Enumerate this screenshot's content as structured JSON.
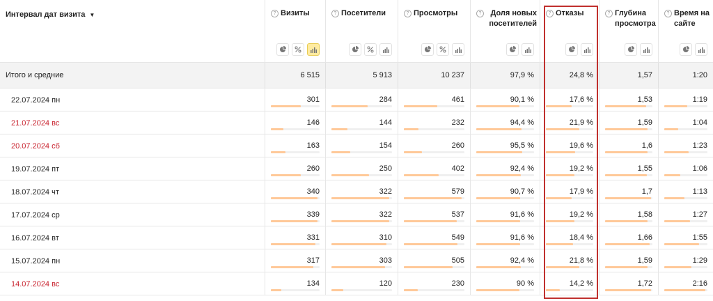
{
  "header": {
    "dimension": {
      "label": "Интервал дат визита",
      "caret": "▼"
    },
    "metrics": [
      {
        "name": "Визиты",
        "tools": [
          "pie-chart-icon",
          "percent-icon",
          "bar-chart-icon"
        ],
        "active_tool": 2
      },
      {
        "name": "Посетители",
        "tools": [
          "pie-chart-icon",
          "percent-icon",
          "bar-chart-icon"
        ],
        "active_tool": -1
      },
      {
        "name": "Просмотры",
        "tools": [
          "pie-chart-icon",
          "percent-icon",
          "bar-chart-icon"
        ],
        "active_tool": -1
      },
      {
        "name": "Доля новых посетителей",
        "tools": [
          "pie-chart-icon",
          "bar-chart-icon"
        ],
        "active_tool": -1
      },
      {
        "name": "Отказы",
        "tools": [
          "pie-chart-icon",
          "bar-chart-icon"
        ],
        "active_tool": -1
      },
      {
        "name": "Глубина просмотра",
        "tools": [
          "pie-chart-icon",
          "bar-chart-icon"
        ],
        "active_tool": -1
      },
      {
        "name": "Время на сайте",
        "tools": [
          "pie-chart-icon",
          "bar-chart-icon"
        ],
        "active_tool": -1
      }
    ],
    "info_glyph": "?"
  },
  "totals": {
    "label": "Итого и средние",
    "values": [
      "6 515",
      "5 913",
      "10 237",
      "97,9 %",
      "24,8 %",
      "1,57",
      "1:20"
    ]
  },
  "rows": [
    {
      "date": "22.07.2024 пн",
      "weekend": false,
      "values": [
        "301",
        "284",
        "461",
        "90,1 %",
        "17,6 %",
        "1,53",
        "1:19"
      ],
      "bars": [
        0.62,
        0.6,
        0.55,
        0.75,
        0.55,
        0.87,
        0.53
      ]
    },
    {
      "date": "21.07.2024 вс",
      "weekend": true,
      "values": [
        "146",
        "144",
        "232",
        "94,4 %",
        "21,9 %",
        "1,59",
        "1:04"
      ],
      "bars": [
        0.25,
        0.27,
        0.24,
        0.78,
        0.7,
        0.9,
        0.33
      ]
    },
    {
      "date": "20.07.2024 сб",
      "weekend": true,
      "values": [
        "163",
        "154",
        "260",
        "95,5 %",
        "19,6 %",
        "1,6",
        "1:23"
      ],
      "bars": [
        0.3,
        0.31,
        0.3,
        0.8,
        0.62,
        0.9,
        0.57
      ]
    },
    {
      "date": "19.07.2024 пт",
      "weekend": false,
      "values": [
        "260",
        "250",
        "402",
        "92,4 %",
        "19,2 %",
        "1,55",
        "1:06"
      ],
      "bars": [
        0.62,
        0.62,
        0.57,
        0.77,
        0.6,
        0.88,
        0.37
      ]
    },
    {
      "date": "18.07.2024 чт",
      "weekend": false,
      "values": [
        "340",
        "322",
        "579",
        "90,7 %",
        "17,9 %",
        "1,7",
        "1:13"
      ],
      "bars": [
        0.95,
        0.95,
        0.95,
        0.76,
        0.55,
        0.97,
        0.47
      ]
    },
    {
      "date": "17.07.2024 ср",
      "weekend": false,
      "values": [
        "339",
        "322",
        "537",
        "91,6 %",
        "19,2 %",
        "1,58",
        "1:27"
      ],
      "bars": [
        0.95,
        0.95,
        0.87,
        0.76,
        0.6,
        0.89,
        0.6
      ]
    },
    {
      "date": "16.07.2024 вт",
      "weekend": false,
      "values": [
        "331",
        "310",
        "549",
        "91,6 %",
        "18,4 %",
        "1,66",
        "1:55"
      ],
      "bars": [
        0.92,
        0.91,
        0.89,
        0.76,
        0.57,
        0.94,
        0.8
      ]
    },
    {
      "date": "15.07.2024 пн",
      "weekend": false,
      "values": [
        "317",
        "303",
        "505",
        "92,4 %",
        "21,8 %",
        "1,59",
        "1:29"
      ],
      "bars": [
        0.87,
        0.88,
        0.81,
        0.77,
        0.7,
        0.9,
        0.63
      ]
    },
    {
      "date": "14.07.2024 вс",
      "weekend": true,
      "values": [
        "134",
        "120",
        "230",
        "90 %",
        "14,2 %",
        "1,72",
        "2:16"
      ],
      "bars": [
        0.22,
        0.2,
        0.23,
        0.75,
        0.3,
        0.97,
        0.95
      ]
    }
  ],
  "colors": {
    "bar_fill": "#ffc999",
    "weekend_text": "#c8202c",
    "highlight_frame": "#c0302e",
    "active_tool_bg": "#ffeba0"
  }
}
